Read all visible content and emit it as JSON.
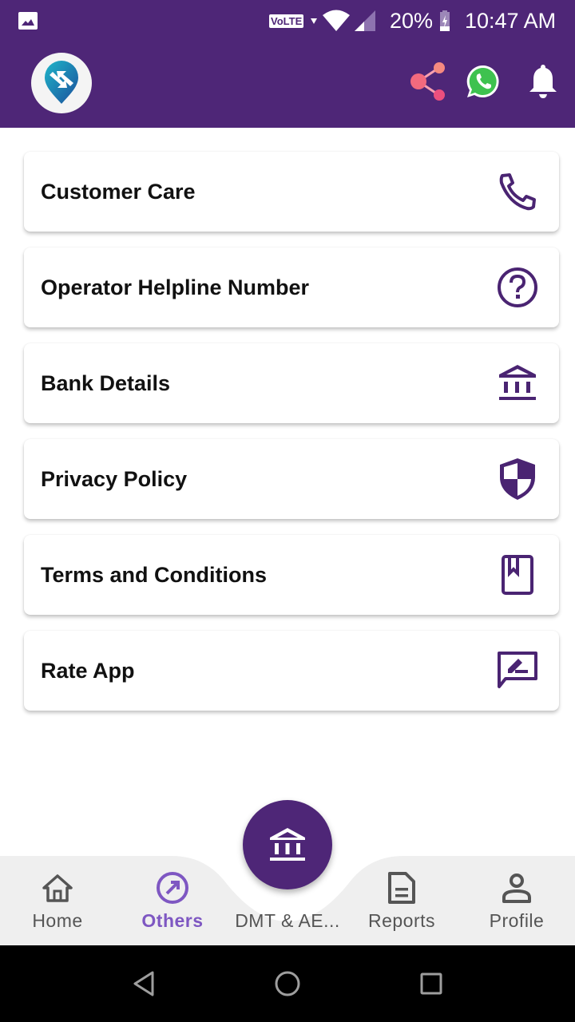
{
  "status_bar": {
    "network_label": "VoLTE",
    "battery": "20%",
    "time": "10:47 AM"
  },
  "app_bar": {
    "logo": "app-logo",
    "actions": [
      {
        "name": "share",
        "icon": "share-icon",
        "color": "#f06292"
      },
      {
        "name": "whatsapp",
        "icon": "whatsapp-icon",
        "color": "#25d366"
      },
      {
        "name": "notifications",
        "icon": "bell-icon",
        "color": "#ffffff"
      }
    ]
  },
  "menu": {
    "items": [
      {
        "label": "Customer Care",
        "icon": "phone-icon"
      },
      {
        "label": "Operator Helpline Number",
        "icon": "help-circle-icon"
      },
      {
        "label": "Bank Details",
        "icon": "bank-icon"
      },
      {
        "label": "Privacy Policy",
        "icon": "shield-icon"
      },
      {
        "label": "Terms and Conditions",
        "icon": "book-icon"
      },
      {
        "label": "Rate App",
        "icon": "rate-review-icon"
      }
    ]
  },
  "bottom_nav": {
    "items": [
      {
        "label": "Home",
        "icon": "home-icon",
        "active": false
      },
      {
        "label": "Others",
        "icon": "arrow-circle-icon",
        "active": true
      },
      {
        "label": "DMT & AE...",
        "icon": "bank-icon",
        "active": false
      },
      {
        "label": "Reports",
        "icon": "document-icon",
        "active": false
      },
      {
        "label": "Profile",
        "icon": "person-icon",
        "active": false
      }
    ]
  },
  "colors": {
    "primary": "#4e2677",
    "accent": "#7e57c2",
    "icon": "#4a2472",
    "nav_bg": "#efefef"
  }
}
